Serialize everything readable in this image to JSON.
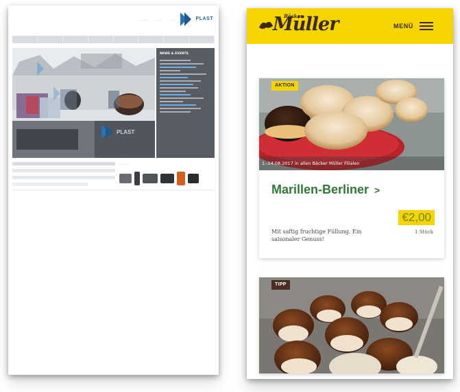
{
  "td_plast_page": {
    "logo_text": "PLAST",
    "util_links": [
      "............",
      "........",
      "........"
    ],
    "nav_items": [
      "",
      "",
      "",
      "",
      "",
      "",
      "",
      "",
      "",
      ""
    ],
    "news_title": "NEWS & EVENTS",
    "products_label": ".........."
  },
  "mueller_page": {
    "brand": {
      "small": "Bäcker",
      "name": "Müller"
    },
    "menu_label": "MENÜ",
    "featured": {
      "badge": "AKTION",
      "caption": "1.-14.08.2017 in allen Bäcker Müller Filialen",
      "title": "Marillen-Berliner",
      "chevron": ">",
      "price": "€2,00",
      "unit": "1 Stück",
      "description": "Mit saftig fruchtige Füllung. Ein saisonaler Genuss!"
    },
    "second": {
      "badge": "TIPP"
    },
    "colors": {
      "yellow": "#f5d400",
      "green": "#2e7a33",
      "brown": "#3a2a10",
      "badge_dark": "#4a2d22"
    }
  }
}
